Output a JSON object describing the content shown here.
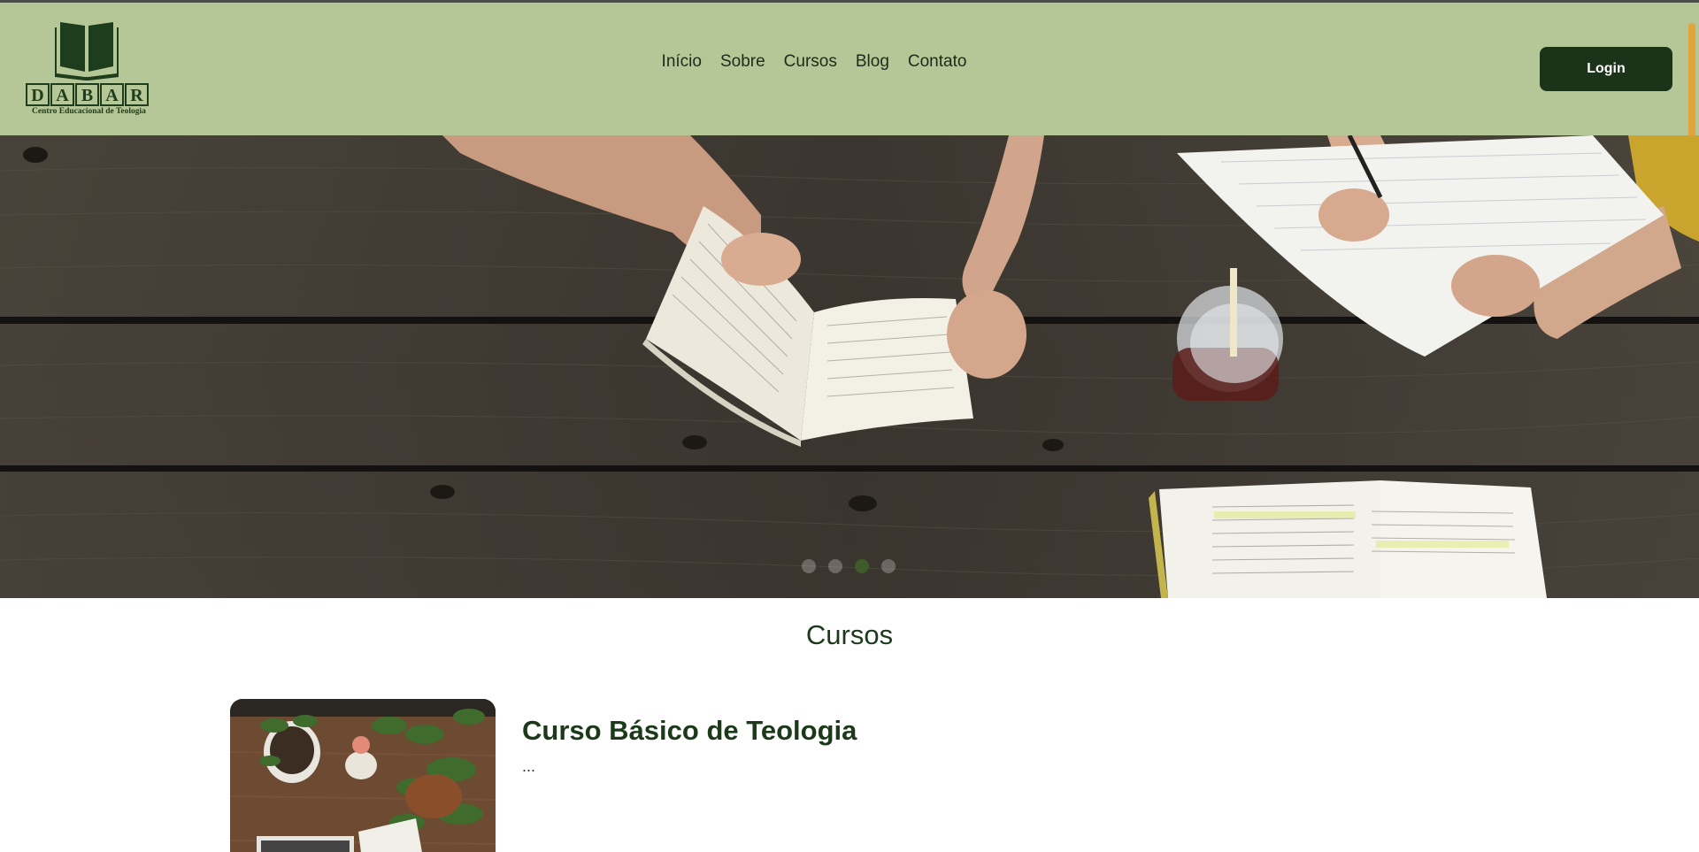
{
  "logo": {
    "letters": [
      "D",
      "A",
      "B",
      "A",
      "R"
    ],
    "subtitle": "Centro Educacional de Teologia"
  },
  "nav": {
    "items": [
      {
        "label": "Início"
      },
      {
        "label": "Sobre"
      },
      {
        "label": "Cursos"
      },
      {
        "label": "Blog"
      },
      {
        "label": "Contato"
      }
    ]
  },
  "header": {
    "login_label": "Login"
  },
  "carousel": {
    "slide_count": 4,
    "active_index": 2
  },
  "courses": {
    "title": "Cursos",
    "items": [
      {
        "title": "Curso Básico de Teologia",
        "description": "..."
      }
    ]
  },
  "colors": {
    "header_bg": "#b6c797",
    "brand_dark": "#1b3319",
    "accent": "#e2a43c"
  }
}
